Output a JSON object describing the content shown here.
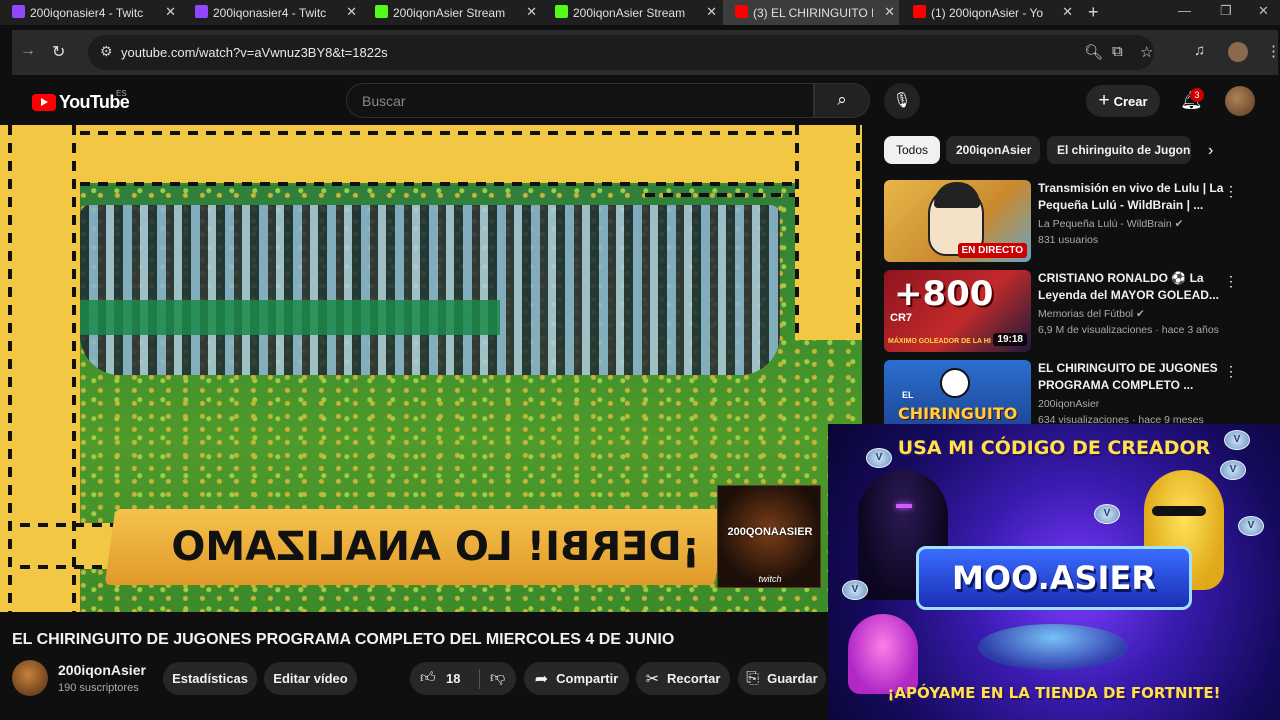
{
  "browser": {
    "tabs": [
      {
        "title": "200iqonasier4 - Twitc",
        "favicon_color": "#9146ff",
        "active": false
      },
      {
        "title": "200iqonasier4 - Twitc",
        "favicon_color": "#9146ff",
        "active": false
      },
      {
        "title": "200iqonAsier Stream",
        "favicon_color": "#53fc18",
        "active": false
      },
      {
        "title": "200iqonAsier Stream",
        "favicon_color": "#53fc18",
        "active": false
      },
      {
        "title": "(3) EL CHIRINGUITO I",
        "favicon_color": "#ff0000",
        "active": true
      },
      {
        "title": "(1) 200iqonAsier - Yo",
        "favicon_color": "#ff0000",
        "active": false
      }
    ],
    "url": "youtube.com/watch?v=aVwnuz3BY8&t=1822s"
  },
  "header": {
    "logo_text": "YouTube",
    "country_code": "ES",
    "search_placeholder": "Buscar",
    "create_label": "Crear",
    "notification_count": "3"
  },
  "video": {
    "overlay_text": "¡DERBI! LO ANALIZAMOS",
    "logo_card_name": "200QONAASIER",
    "logo_card_sub": "twitch",
    "title": "EL CHIRINGUITO DE JUGONES PROGRAMA COMPLETO DEL MIERCOLES 4 DE JUNIO",
    "channel_name": "200iqonAsier",
    "subscribers": "190 suscriptores",
    "actions": {
      "stats": "Estadísticas",
      "edit": "Editar vídeo",
      "likes": "18",
      "share": "Compartir",
      "clip": "Recortar",
      "save": "Guardar"
    }
  },
  "sidebar": {
    "chips": [
      "Todos",
      "200iqonAsier",
      "El chiringuito de Jugones"
    ],
    "recommendations": [
      {
        "title": "Transmisión en vivo de Lulu | La Pequeña Lulú - WildBrain | ...",
        "channel": "La Pequeña Lulú - WildBrain",
        "meta": "831 usuarios",
        "badge": "EN DIRECTO",
        "verified": true
      },
      {
        "title": "CRISTIANO RONALDO ⚽ La Leyenda del MAYOR GOLEAD...",
        "channel": "Memorias del Fútbol",
        "meta": "6,9 M de visualizaciones · hace 3 años",
        "badge": "19:18",
        "thumb_text": "+800",
        "thumb_sub": "CR7",
        "thumb_caption": "MÁXIMO GOLEADOR DE LA HI",
        "verified": true
      },
      {
        "title": "EL CHIRINGUITO DE JUGONES PROGRAMA COMPLETO ...",
        "channel": "200iqonAsier",
        "meta": "634 visualizaciones · hace 9 meses",
        "thumb_text": "CHIRINGUITO",
        "thumb_sub": "EL",
        "verified": false
      }
    ]
  },
  "overlay": {
    "top_text": "USA MI CÓDIGO DE CREADOR",
    "creator_code": "MOO.ASIER",
    "bottom_text": "¡APÓYAME EN LA TIENDA DE FORTNITE!",
    "coin_label": "V"
  }
}
